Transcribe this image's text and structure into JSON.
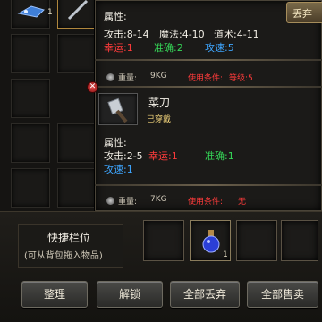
{
  "inventory": {
    "slot_top_left_qty": "1"
  },
  "tooltip_top": {
    "header": "属性:",
    "stats_line": [
      "攻击:8-14",
      "魔法:4-10",
      "道术:4-11"
    ],
    "mods_line": [
      "幸运:1",
      "准确:2",
      "攻速:5"
    ],
    "weight": "重量:",
    "weight_value": "9KG",
    "use_cond_label": "使用条件:",
    "use_cond_value": "等级:5",
    "discard_label": "丢弃"
  },
  "tooltip_item": {
    "name": "菜刀",
    "status": "已穿戴",
    "header": "属性:",
    "attack": "攻击:2-5",
    "luck": "幸运:1",
    "accuracy": "准确:1",
    "speed": "攻速:1",
    "weight": "重量:",
    "weight_value": "7KG",
    "use_cond_label": "使用条件:",
    "use_cond_value": "无"
  },
  "quickbar": {
    "title": "快捷栏位",
    "hint": "(可从背包拖入物品)",
    "potion_qty": "1"
  },
  "buttons": {
    "organize": "整理",
    "unlock": "解锁",
    "discard_all": "全部丢弃",
    "sell_all": "全部售卖"
  },
  "colors": {
    "luck": "#ff3b3b",
    "accuracy": "#35d657",
    "speed": "#3ea6ff",
    "status": "#f0d27a",
    "requirement": "#ff3b3b"
  }
}
